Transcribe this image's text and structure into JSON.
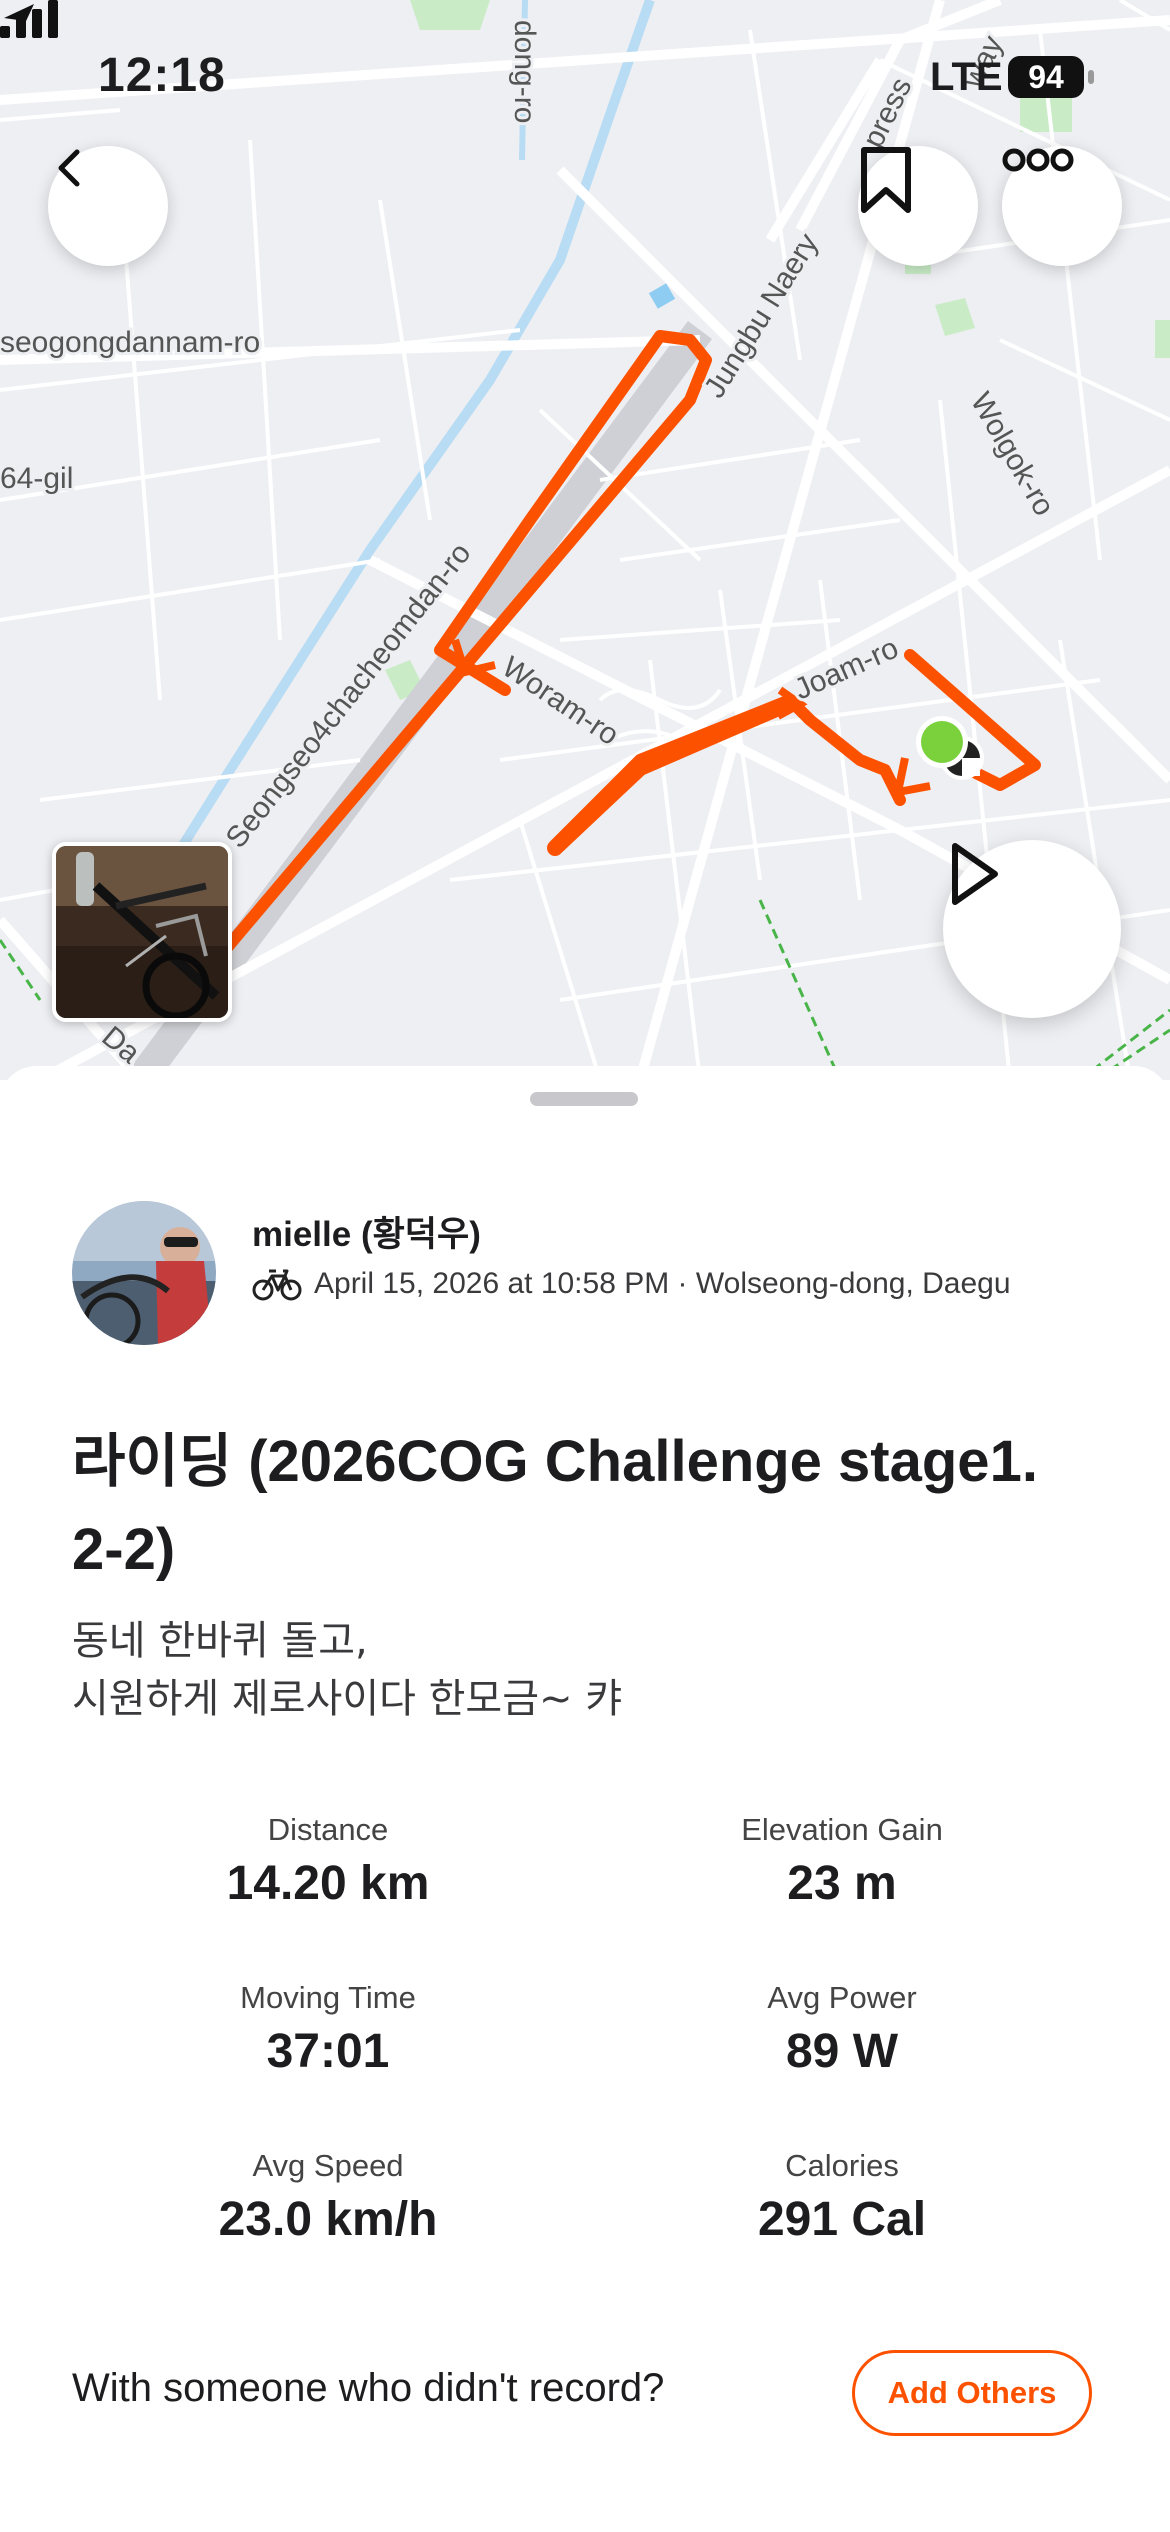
{
  "status_bar": {
    "time": "12:18",
    "network": "LTE",
    "battery": "94"
  },
  "map": {
    "street_labels": [
      "seogongdannam-ro",
      "64-gil",
      "Seongseo4chacheomdan-ro",
      "Woram-ro",
      "Joam-ro",
      "Jungbu Naery",
      "Wolgok-ro",
      "dong-ro",
      "press",
      "way",
      "Da"
    ],
    "route_color": "#fc5200",
    "icons": {
      "back": "chevron-left-icon",
      "save": "bookmark-icon",
      "more": "more-icon",
      "play": "play-icon"
    }
  },
  "activity": {
    "athlete_name": "mielle (황덕우)",
    "meta": "April 15, 2026 at 10:58 PM · Wolseong-dong, Daegu",
    "title": "라이딩 (2026COG Challenge stage1. 2-2)",
    "description_lines": [
      "동네 한바퀴 돌고,",
      "시원하게 제로사이다 한모금~ 캬"
    ],
    "stats": [
      {
        "label": "Distance",
        "value": "14.20 km"
      },
      {
        "label": "Elevation Gain",
        "value": "23 m"
      },
      {
        "label": "Moving Time",
        "value": "37:01"
      },
      {
        "label": "Avg Power",
        "value": "89 W"
      },
      {
        "label": "Avg Speed",
        "value": "23.0 km/h"
      },
      {
        "label": "Calories",
        "value": "291 Cal"
      }
    ],
    "add_others_prompt": "With someone who didn't record?",
    "add_others_label": "Add Others"
  }
}
